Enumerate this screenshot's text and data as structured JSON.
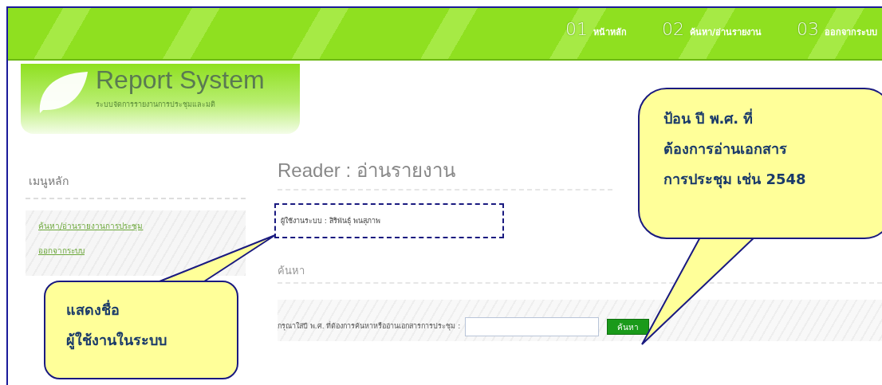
{
  "nav": [
    {
      "number": "01",
      "label": "หน้าหลัก"
    },
    {
      "number": "02",
      "label": "ค้นหา/อ่านรายงาน"
    },
    {
      "number": "03",
      "label": "ออกจากระบบ"
    }
  ],
  "logo": {
    "title": "Report System",
    "subtitle": "ระบบจัดการรายงานการประชุมและมติ"
  },
  "sidebar": {
    "heading": "เมนูหลัก",
    "links": [
      "ค้นหา/อ่านรายงานการประชุม",
      "ออกจากระบบ"
    ]
  },
  "main": {
    "title": "Reader : อ่านรายงาน",
    "user": "ผู้ใช้งานระบบ : สิริพันธุ์ พนสุภาพ",
    "section": "ค้นหา",
    "search": {
      "label": "กรุณาใส่ปี พ.ศ. ที่ต้องการค้นหาหรืออ่านเอกสารการประชุม :",
      "button": "ค้นหา"
    }
  },
  "callouts": [
    {
      "lines": [
        "ป้อน ปี พ.ศ. ที่",
        "ต้องการอ่านเอกสาร",
        "การประชุม เช่น 2548"
      ]
    },
    {
      "lines": [
        "แสดงชื่อ",
        "ผู้ใช้งานในระบบ"
      ]
    }
  ]
}
